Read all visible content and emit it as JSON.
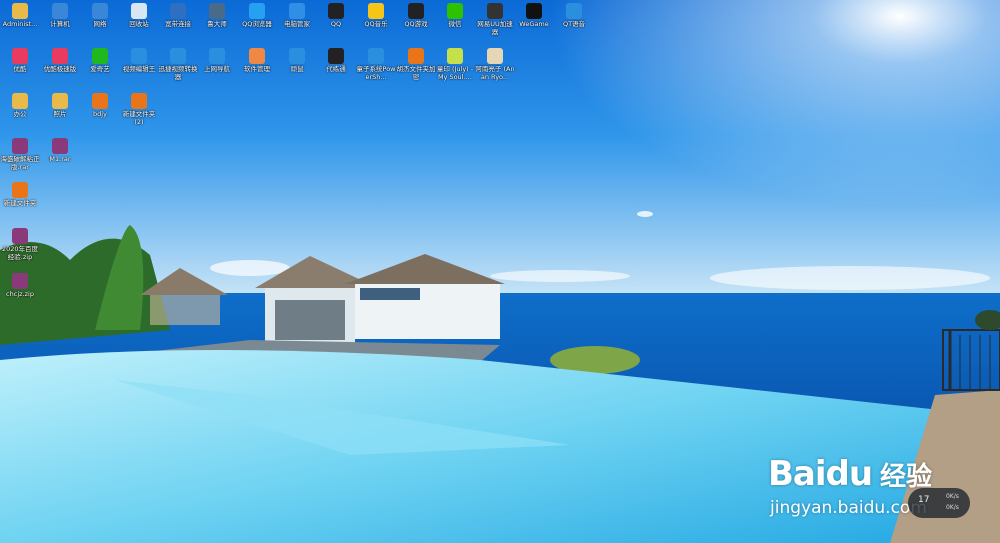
{
  "desktop": {
    "icons": [
      {
        "name": "administrator-icon",
        "label": "Administ...",
        "icon": "user-folder-icon",
        "color": "#e9b949"
      },
      {
        "name": "computer-icon",
        "label": "计算机",
        "icon": "monitor-icon",
        "color": "#3a86d9"
      },
      {
        "name": "network-icon",
        "label": "网络",
        "icon": "network-icon",
        "color": "#3a86d9"
      },
      {
        "name": "recycle-bin-icon",
        "label": "回收站",
        "icon": "trash-icon",
        "color": "#d7e6f3"
      },
      {
        "name": "broadband-icon",
        "label": "宽带连接",
        "icon": "broadband-icon",
        "color": "#2e6fc2"
      },
      {
        "name": "ludashi-icon",
        "label": "鲁大师",
        "icon": "ludashi-icon",
        "color": "#4a6a8a"
      },
      {
        "name": "qq-browser-icon",
        "label": "QQ浏览器",
        "icon": "qq-browser-icon",
        "color": "#26a0f0"
      },
      {
        "name": "pc-manager-icon",
        "label": "电脑管家",
        "icon": "shield-icon",
        "color": "#2f8fe6"
      },
      {
        "name": "qq-icon",
        "label": "QQ",
        "icon": "penguin-icon",
        "color": "#222"
      },
      {
        "name": "qq-music-icon",
        "label": "QQ音乐",
        "icon": "music-icon",
        "color": "#f5c518"
      },
      {
        "name": "qq-game-icon",
        "label": "QQ游戏",
        "icon": "penguin-icon",
        "color": "#222"
      },
      {
        "name": "wechat-icon",
        "label": "微信",
        "icon": "chat-icon",
        "color": "#2dc100"
      },
      {
        "name": "netease-uu-icon",
        "label": "网易UU加速器",
        "icon": "uu-icon",
        "color": "#333"
      },
      {
        "name": "wegame-icon",
        "label": "WeGame",
        "icon": "wegame-icon",
        "color": "#111"
      },
      {
        "name": "qt-voice-icon",
        "label": "QT语音",
        "icon": "qt-icon",
        "color": "#2b8fe0"
      },
      {
        "name": "youku-icon",
        "label": "优酷",
        "icon": "play-icon",
        "color": "#e93b5f"
      },
      {
        "name": "youku-speed-icon",
        "label": "优酷极速版",
        "icon": "play-icon",
        "color": "#e93b5f"
      },
      {
        "name": "iqiyi-icon",
        "label": "爱奇艺",
        "icon": "iqiyi-icon",
        "color": "#1fb81f"
      },
      {
        "name": "video-editor-icon",
        "label": "视频编辑王",
        "icon": "video-icon",
        "color": "#2b8fe0"
      },
      {
        "name": "video-converter-icon",
        "label": "迅捷视频转换器",
        "icon": "video-icon",
        "color": "#2b8fe0"
      },
      {
        "name": "hao123-icon",
        "label": "上网导航",
        "icon": "browser-icon",
        "color": "#2b8fe0"
      },
      {
        "name": "software-manager-icon",
        "label": "软件管理",
        "icon": "apps-icon",
        "color": "#e84"
      },
      {
        "name": "game-icon",
        "label": "顽鼠",
        "icon": "game-icon",
        "color": "#2b8fe0"
      },
      {
        "name": "dai-lian-icon",
        "label": "代练通",
        "icon": "hat-icon",
        "color": "#222"
      },
      {
        "name": "powershell-icon",
        "label": "童子系统PowerSh...",
        "icon": "apps-icon",
        "color": "#2b8fe0"
      },
      {
        "name": "file-encrypt-icon",
        "label": "胡杰文件夹加密",
        "icon": "lock-icon",
        "color": "#e8751a"
      },
      {
        "name": "audio-file-icon",
        "label": "童印 (July) - My Soul.…",
        "icon": "audio-icon",
        "color": "#c5e04b"
      },
      {
        "name": "image-file-icon",
        "label": "阿南亮子 (Anan Ryo...",
        "icon": "image-icon",
        "color": "#e5d7b5"
      },
      {
        "name": "office-folder-icon",
        "label": "办公",
        "icon": "folder-icon",
        "color": "#e9b949"
      },
      {
        "name": "photos-folder-icon",
        "label": "照片",
        "icon": "folder-icon",
        "color": "#e9b949"
      },
      {
        "name": "bdjy-icon",
        "label": "bdjy",
        "icon": "lock-icon",
        "color": "#e8751a"
      },
      {
        "name": "new-folder-2-icon",
        "label": "新建文件夹 (2)",
        "icon": "lock-icon",
        "color": "#e8751a"
      },
      {
        "name": "rar-archive-icon",
        "label": "海盛破解粘正版.rar",
        "icon": "rar-icon",
        "color": "#8a3a7a"
      },
      {
        "name": "m1-rar-icon",
        "label": "M1.rar",
        "icon": "rar-icon",
        "color": "#8a3a7a"
      },
      {
        "name": "new-folder-icon",
        "label": "新建文件夹",
        "icon": "lock-icon",
        "color": "#e8751a"
      },
      {
        "name": "zip-archive-icon",
        "label": "2020年百度经验.zip",
        "icon": "rar-icon",
        "color": "#8a3a7a"
      },
      {
        "name": "zip-archive-2-icon",
        "label": "chcjz.zip",
        "icon": "rar-icon",
        "color": "#8a3a7a"
      }
    ],
    "watermark": {
      "brand": "Baidu",
      "cn": "经验",
      "url": "jingyan.baidu.com"
    },
    "widget": {
      "number": "17",
      "up": "0K/s",
      "down": "0K/s"
    }
  }
}
